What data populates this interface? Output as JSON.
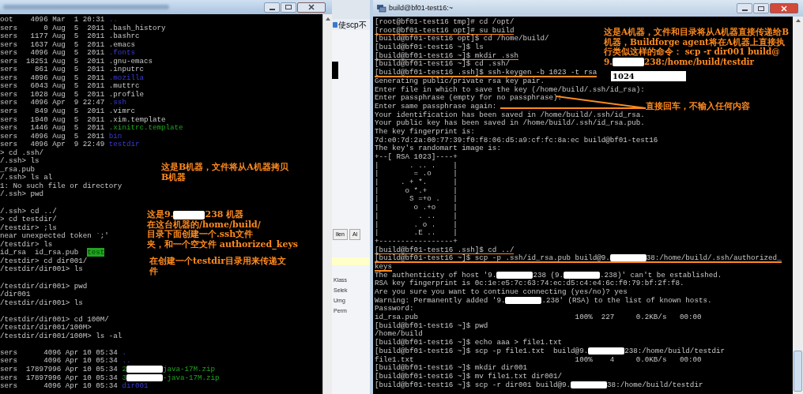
{
  "left_terminal": {
    "lines": [
      [
        "oot    4096 Mar  1 20:31 ",
        {
          "kind": "dir",
          "text": ".."
        }
      ],
      [
        "sers      0 Aug  5  2011 .bash_history"
      ],
      [
        "sers   1177 Aug  5  2011 .bashrc"
      ],
      [
        "sers   1637 Aug  5  2011 .emacs"
      ],
      [
        "sers   4096 Aug  5  2011 ",
        {
          "kind": "dir",
          "text": ".fonts"
        }
      ],
      [
        "sers  18251 Aug  5  2011 .gnu-emacs"
      ],
      [
        "sers    861 Aug  5  2011 .inputrc"
      ],
      [
        "sers   4096 Aug  5  2011 ",
        {
          "kind": "dir",
          "text": ".mozilla"
        }
      ],
      [
        "sers   6043 Aug  5  2011 .muttrc"
      ],
      [
        "sers   1028 Aug  5  2011 .profile"
      ],
      [
        "sers   4096 Apr  9 22:47 ",
        {
          "kind": "dir",
          "text": ".ssh"
        }
      ],
      [
        "sers    849 Aug  5  2011 .vimrc"
      ],
      [
        "sers   1940 Aug  5  2011 .xim.template"
      ],
      [
        "sers   1446 Aug  5  2011 ",
        {
          "kind": "exec",
          "text": ".xinitrc.template"
        }
      ],
      [
        "sers   4096 Aug  5  2011 ",
        {
          "kind": "dir",
          "text": "bin"
        }
      ],
      [
        "sers   4096 Apr  9 22:49 ",
        {
          "kind": "dir",
          "text": "testdir"
        }
      ],
      [
        "> cd .ssh/"
      ],
      [
        "/.ssh> ls"
      ],
      [
        "_rsa.pub"
      ],
      [
        "/.ssh> ls al"
      ],
      [
        "1: No such file or directory"
      ],
      [
        "/.ssh> pwd"
      ],
      {
        "gap": true,
        "s": [
          "/.ssh> cd ../"
        ]
      },
      [
        "> cd testdir/"
      ],
      [
        "/testdir> ;ls"
      ],
      [
        "near unexpected token `;'"
      ],
      [
        "/testdir> ls"
      ],
      [
        "id_rsa  id_rsa.pub  ",
        {
          "kind": "highlight",
          "text": "test"
        }
      ],
      [
        "/testdir> cd dir001/"
      ],
      [
        "/testdir/dir001> ls"
      ],
      {
        "gap": true,
        "s": [
          "/testdir/dir001> pwd"
        ]
      },
      [
        "/dir001"
      ],
      [
        "/testdir/dir001> ls"
      ],
      {
        "gap": true,
        "s": [
          "/testdir/dir001> cd 100M/"
        ]
      },
      [
        "/testdir/dir001/100M>"
      ],
      [
        "/testdir/dir001/100M> ls -al"
      ],
      {
        "gap": true,
        "s": [
          "sers      4096 Apr 10 05:34 ",
          {
            "kind": "dir",
            "text": "."
          }
        ]
      },
      [
        "sers      4096 Apr 10 05:34 ",
        {
          "kind": "dir",
          "text": ".."
        }
      ],
      [
        "sers  17897996 Apr 10 05:34 ",
        {
          "kind": "exec",
          "text": "2"
        },
        {
          "kind": "redacted"
        },
        {
          "kind": "exec",
          "text": "java-17M.zip"
        }
      ],
      [
        "sers  17897996 Apr 10 05:34 ",
        {
          "kind": "exec",
          "text": "3"
        },
        {
          "kind": "redacted"
        },
        {
          "kind": "exec",
          "text": "-java-17M.zip"
        }
      ],
      [
        "sers      4096 Apr 10 05:34 ",
        {
          "kind": "dir",
          "text": "dir001"
        }
      ]
    ]
  },
  "background_window": {
    "tab": "使scp不",
    "buttons": [
      "llen",
      "Al"
    ],
    "labels": [
      "Klass",
      "Selek",
      "Umg",
      "Perm"
    ]
  },
  "terminal": {
    "title": "build@bf01-test16:~",
    "lines": [
      {
        "segments": [
          "[root@bf01-test16 tmp]# cd /opt/"
        ],
        "underlined": false
      },
      {
        "segments": [
          "[root@bf01-test16 opt]# su build"
        ],
        "underlined": true
      },
      {
        "segments": [
          "[build@bf01-test16 opt]$ cd /home/build/"
        ],
        "underlined": false
      },
      {
        "segments": [
          "[build@bf01-test16 ~]$ ls"
        ],
        "underlined": false
      },
      {
        "segments": [
          "[build@bf01-test16 ~]$ mkdir .ssh"
        ],
        "underlined": true
      },
      {
        "segments": [
          "[build@bf01-test16 ~]$ cd .ssh/"
        ],
        "underlined": false
      },
      {
        "segments": [
          "[build@bf01-test16 .ssh]$ ssh-keygen -b 1023 -t rsa"
        ],
        "underlined": true
      },
      {
        "segments": [
          "Generating public/private rsa key pair."
        ],
        "underlined": false
      },
      {
        "segments": [
          "Enter file in which to save the key (/home/build/.ssh/id_rsa):"
        ],
        "underlined": false
      },
      {
        "segments": [
          "Enter passphrase (empty for no passphrase):"
        ],
        "underlined": false
      },
      {
        "segments": [
          "Enter same passphrase again:"
        ],
        "underlined": false
      },
      {
        "segments": [
          "Your identification has been saved in /home/build/.ssh/id_rsa."
        ],
        "underlined": false
      },
      {
        "segments": [
          "Your public key has been saved in /home/build/.ssh/id_rsa.pub."
        ],
        "underlined": false
      },
      {
        "segments": [
          "The key fingerprint is:"
        ],
        "underlined": false
      },
      {
        "segments": [
          "7d:e0:7d:2a:00:77:39:f0:f8:06:d5:a9:cf:fc:8a:ec build@bf01-test16"
        ],
        "underlined": false
      },
      {
        "segments": [
          "The key's randomart image is:"
        ],
        "underlined": false
      },
      {
        "segments": [
          "+--[ RSA 1023]----+"
        ],
        "underlined": false
      },
      {
        "segments": [
          "|       . .. .    |"
        ],
        "underlined": false
      },
      {
        "segments": [
          "|        = .o     |"
        ],
        "underlined": false
      },
      {
        "segments": [
          "|     . + *.      |"
        ],
        "underlined": false
      },
      {
        "segments": [
          "|      o *.+      |"
        ],
        "underlined": false
      },
      {
        "segments": [
          "|       S =+o .   |"
        ],
        "underlined": false
      },
      {
        "segments": [
          "|        o .+o    |"
        ],
        "underlined": false
      },
      {
        "segments": [
          "|         . ..    |"
        ],
        "underlined": false
      },
      {
        "segments": [
          "|        . o .    |"
        ],
        "underlined": false
      },
      {
        "segments": [
          "|        .E ..    |"
        ],
        "underlined": false
      },
      {
        "segments": [
          "+-----------------+"
        ],
        "underlined": false
      },
      {
        "segments": [
          "[build@bf01-test16 .ssh]$ cd ../"
        ],
        "underlined": true
      },
      {
        "segments": [
          "[build@bf01-test16 ~]$ scp -p .ssh/id_rsa.pub build@9.",
          {
            "kind": "redacted"
          },
          "38:/home/build/.ssh/authorized_"
        ],
        "underlined": true
      },
      {
        "segments": [
          "keys"
        ],
        "underlined": true
      },
      {
        "segments": [
          "The authenticity of host '9.",
          {
            "kind": "redacted"
          },
          "238 (9.",
          {
            "kind": "redacted"
          },
          ".238)' can't be established."
        ],
        "underlined": false
      },
      {
        "segments": [
          "RSA key fingerprint is 0c:1e:e5:7c:63:74:ec:d5:c4:e4:6c:f0:79:bf:2f:f8."
        ],
        "underlined": false
      },
      {
        "segments": [
          "Are you sure you want to continue connecting (yes/no)? yes"
        ],
        "underlined": false
      },
      {
        "segments": [
          "Warning: Permanently added '9.",
          {
            "kind": "redacted"
          },
          ".238' (RSA) to the list of known hosts."
        ],
        "underlined": false
      },
      {
        "segments": [
          "Password:"
        ],
        "underlined": false
      },
      {
        "segments": [
          "id_rsa.pub                                    100%  227     0.2KB/s   00:00"
        ],
        "underlined": false
      },
      {
        "segments": [
          "[build@bf01-test16 ~]$ pwd"
        ],
        "underlined": false
      },
      {
        "segments": [
          "/home/build"
        ],
        "underlined": false
      },
      {
        "segments": [
          "[build@bf01-test16 ~]$ echo aaa > file1.txt"
        ],
        "underlined": false
      },
      {
        "segments": [
          "[build@bf01-test16 ~]$ scp -p file1.txt  build@9.",
          {
            "kind": "redacted"
          },
          "238:/home/build/testdir"
        ],
        "underlined": false
      },
      {
        "segments": [
          "file1.txt                                     100%    4     0.0KB/s   00:00"
        ],
        "underlined": false
      },
      {
        "segments": [
          "[build@bf01-test16 ~]$ mkdir dir001"
        ],
        "underlined": false
      },
      {
        "segments": [
          "[build@bf01-test16 ~]$ mv file1.txt dir001/"
        ],
        "underlined": false
      },
      {
        "segments": [
          "[build@bf01-test16 ~]$ scp -r dir001 build@9.",
          {
            "kind": "redacted"
          },
          "38:/home/build/testdir"
        ],
        "underlined": false
      }
    ]
  },
  "annotations": [
    {
      "kind": "note",
      "lines": [
        [
          "这是B机器，文件将从A机器拷贝"
        ],
        [
          "B机器"
        ]
      ]
    },
    {
      "kind": "note",
      "lines": [
        [
          "这是9.",
          {
            "kind": "redacted"
          },
          "238 机器"
        ],
        [
          "在这台机器的/home/build/"
        ],
        [
          "目录下面创建一个.ssh文件"
        ],
        [
          "夹，和一个空文件 authorized_keys"
        ]
      ]
    },
    {
      "kind": "note",
      "lines": [
        [
          "在创建一个testdir目录用来传递文"
        ],
        [
          "件"
        ]
      ]
    },
    {
      "kind": "note",
      "lines": [
        [
          "这是A机器，文件和目录将从A机器直接传递给B"
        ],
        [
          "机器，Buildforge agent将在A机器上直接执"
        ],
        [
          "行类似这样的命令： scp -r dir001 build@"
        ],
        [
          "9.",
          {
            "kind": "redacted"
          },
          "238:/home/build/testdir"
        ]
      ]
    },
    {
      "kind": "correction",
      "lines": [
        [
          "1024"
        ]
      ]
    },
    {
      "kind": "note",
      "lines": [
        [
          "直接回车，不输入任何内容"
        ]
      ]
    }
  ]
}
